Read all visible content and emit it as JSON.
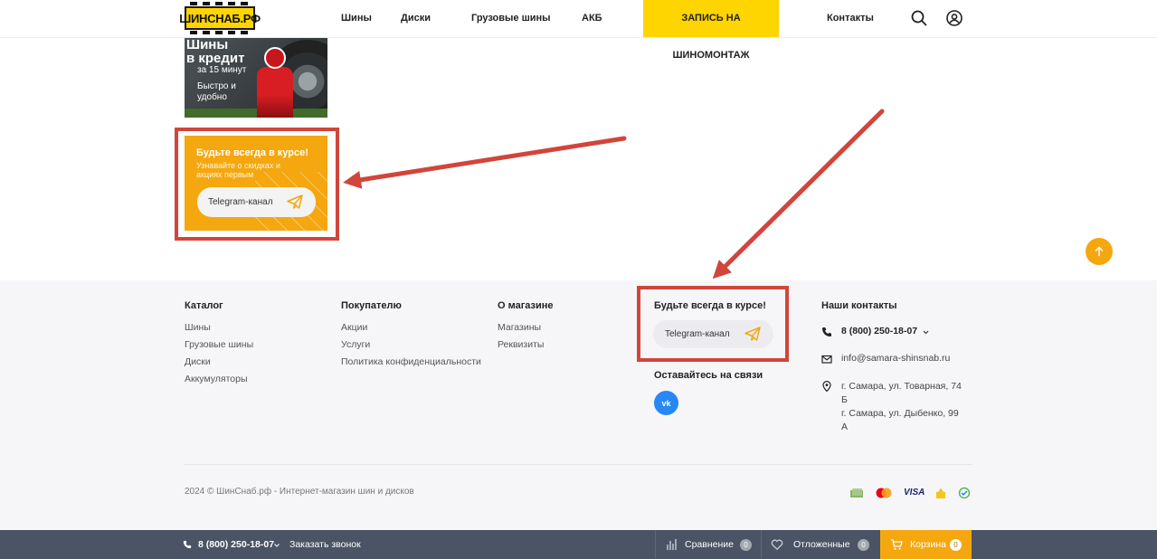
{
  "header": {
    "logo": "ШИНСНАБ.РФ",
    "nav": [
      "Шины",
      "Диски",
      "Грузовые шины",
      "АКБ"
    ],
    "cta": "ЗАПИСЬ НА ШИНОМОНТАЖ",
    "contacts": "Контакты",
    "icons": [
      "search-icon",
      "user-icon"
    ]
  },
  "credit_banner": {
    "line1": "Шины",
    "line2": "в кредит",
    "line3": "за 15 минут",
    "line4": "Быстро и удобно"
  },
  "promo": {
    "title": "Будьте всегда в курсе!",
    "subtitle": "Узнавайте о скидках и акциях первым",
    "button": "Telegram-канал"
  },
  "footer": {
    "catalog": {
      "title": "Каталог",
      "links": [
        "Шины",
        "Грузовые шины",
        "Диски",
        "Аккумуляторы"
      ]
    },
    "buyer": {
      "title": "Покупателю",
      "links": [
        "Акции",
        "Услуги",
        "Политика конфиденциальности"
      ]
    },
    "about": {
      "title": "О магазине",
      "links": [
        "Магазины",
        "Реквизиты"
      ]
    },
    "subscribe": {
      "title": "Будьте всегда в курсе!",
      "button": "Telegram-канал",
      "social_title": "Оставайтесь на связи",
      "vk": "vk"
    },
    "contacts": {
      "title": "Наши контакты",
      "phone": "8 (800) 250-18-07",
      "email": "info@samara-shinsnab.ru",
      "address1_line1": "г. Самара, ул. Товарная, 74",
      "address1_line2": "Б",
      "address2_line1": "г. Самара, ул. Дыбенко, 99",
      "address2_line2": "А"
    },
    "copyright": "2024 © ШинСнаб.рф - Интернет-магазин шин и дисков",
    "payment_icons": [
      "cash-icon",
      "mastercard-icon",
      "visa-icon",
      "wallet-icon",
      "sbp-icon"
    ],
    "visa": "VISA"
  },
  "bottombar": {
    "phone": "8 (800) 250-18-07",
    "callback": "Заказать звонок",
    "compare": "Сравнение",
    "compare_count": "0",
    "favorites": "Отложенные",
    "favorites_count": "0",
    "cart": "Корзина",
    "cart_count": "0"
  },
  "colors": {
    "accent_yellow": "#ffd500",
    "promo_orange": "#f5a70f",
    "highlight_red": "#d1453b",
    "bottombar": "#4a5464",
    "vk_blue": "#2787f5"
  }
}
